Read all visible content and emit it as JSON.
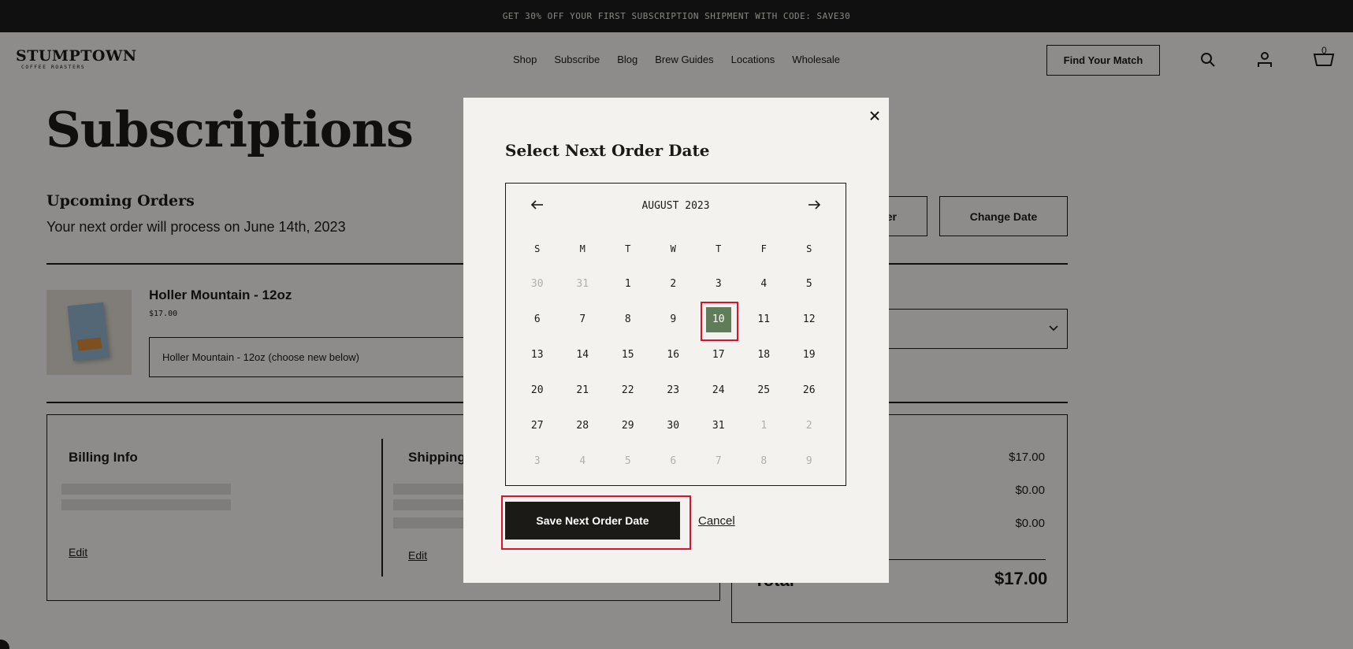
{
  "promo_bar": {
    "text": "GET 30% OFF YOUR FIRST SUBSCRIPTION SHIPMENT WITH CODE: SAVE30"
  },
  "header": {
    "logo_main": "STUMPTOWN",
    "logo_sub": "COFFEE ROASTERS",
    "nav": [
      "Shop",
      "Subscribe",
      "Blog",
      "Brew Guides",
      "Locations",
      "Wholesale"
    ],
    "cta": "Find Your Match",
    "cart_count": "0",
    "icons": [
      "search-icon",
      "account-icon",
      "cart-icon"
    ]
  },
  "page": {
    "title": "Subscriptions",
    "upcoming_heading": "Upcoming Orders",
    "next_order_prefix": "Your next order will process on ",
    "next_order_date": "June 14th, 2023",
    "button_partial": "er",
    "change_date": "Change Date"
  },
  "product": {
    "name": "Holler Mountain - 12oz",
    "price": "$17.00",
    "select_value": "Holler Mountain - 12oz (choose new below)"
  },
  "billing": {
    "heading": "Billing Info",
    "edit": "Edit"
  },
  "shipping": {
    "heading": "Shipping",
    "edit": "Edit"
  },
  "summary": {
    "values": [
      "$17.00",
      "$0.00",
      "$0.00"
    ],
    "total_label": "Total",
    "total": "$17.00"
  },
  "modal": {
    "title": "Select Next Order Date",
    "month": "AUGUST 2023",
    "weekdays": [
      "S",
      "M",
      "T",
      "W",
      "T",
      "F",
      "S"
    ],
    "weeks": [
      [
        "30",
        "31",
        "1",
        "2",
        "3",
        "4",
        "5"
      ],
      [
        "6",
        "7",
        "8",
        "9",
        "10",
        "11",
        "12"
      ],
      [
        "13",
        "14",
        "15",
        "16",
        "17",
        "18",
        "19"
      ],
      [
        "20",
        "21",
        "22",
        "23",
        "24",
        "25",
        "26"
      ],
      [
        "27",
        "28",
        "29",
        "30",
        "31",
        "1",
        "2"
      ],
      [
        "3",
        "4",
        "5",
        "6",
        "7",
        "8",
        "9"
      ]
    ],
    "muted_days": [
      [
        0,
        0
      ],
      [
        0,
        1
      ],
      [
        4,
        5
      ],
      [
        4,
        6
      ],
      [
        5,
        0
      ],
      [
        5,
        1
      ],
      [
        5,
        2
      ],
      [
        5,
        3
      ],
      [
        5,
        4
      ],
      [
        5,
        5
      ],
      [
        5,
        6
      ]
    ],
    "selected_day": "10",
    "save_label": "Save Next Order Date",
    "cancel_label": "Cancel"
  },
  "colors": {
    "accent_selected": "#5f7d58",
    "highlight": "#e0102a",
    "dark": "#1c1a17"
  }
}
